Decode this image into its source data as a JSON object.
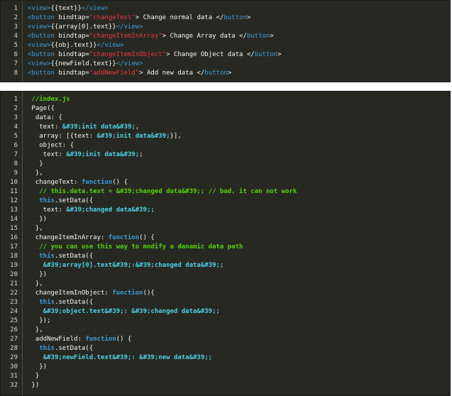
{
  "wxml_snippet": {
    "lines": [
      [
        {
          "t": "<view>",
          "c": "tag"
        },
        {
          "t": "{{text}}",
          "c": "pl"
        },
        {
          "t": "</view>",
          "c": "tag"
        }
      ],
      [
        {
          "t": "<button",
          "c": "tag"
        },
        {
          "t": " bindtap=",
          "c": "pl"
        },
        {
          "t": "\"changeText\"",
          "c": "str"
        },
        {
          "t": "> Change normal data </",
          "c": "pl"
        },
        {
          "t": "button",
          "c": "tag"
        },
        {
          "t": ">",
          "c": "pl"
        }
      ],
      [
        {
          "t": "<view>",
          "c": "tag"
        },
        {
          "t": "{{array[0].text}}",
          "c": "pl"
        },
        {
          "t": "</view>",
          "c": "tag"
        }
      ],
      [
        {
          "t": "<button",
          "c": "tag"
        },
        {
          "t": " bindtap=",
          "c": "pl"
        },
        {
          "t": "\"changeItemInArray\"",
          "c": "str"
        },
        {
          "t": "> Change Array data </",
          "c": "pl"
        },
        {
          "t": "button",
          "c": "tag"
        },
        {
          "t": ">",
          "c": "pl"
        }
      ],
      [
        {
          "t": "<view>",
          "c": "tag"
        },
        {
          "t": "{{obj.text}}",
          "c": "pl"
        },
        {
          "t": "</view>",
          "c": "tag"
        }
      ],
      [
        {
          "t": "<button",
          "c": "tag"
        },
        {
          "t": " bindtap=",
          "c": "pl"
        },
        {
          "t": "\"changeItemInObject\"",
          "c": "str"
        },
        {
          "t": "> Change Object data </",
          "c": "pl"
        },
        {
          "t": "button",
          "c": "tag"
        },
        {
          "t": ">",
          "c": "pl"
        }
      ],
      [
        {
          "t": "<view>",
          "c": "tag"
        },
        {
          "t": "{{newField.text}}",
          "c": "pl"
        },
        {
          "t": "</view>",
          "c": "tag"
        }
      ],
      [
        {
          "t": "<button",
          "c": "tag"
        },
        {
          "t": " bindtap=",
          "c": "pl"
        },
        {
          "t": "\"addNewField\"",
          "c": "str"
        },
        {
          "t": "> Add new data </",
          "c": "pl"
        },
        {
          "t": "button",
          "c": "tag"
        },
        {
          "t": ">",
          "c": "pl"
        }
      ]
    ]
  },
  "js_snippet": {
    "lines": [
      [
        {
          "t": " //index.js",
          "c": "cm"
        }
      ],
      [
        {
          "t": " Page({",
          "c": "pl"
        }
      ],
      [
        {
          "t": "  data: {",
          "c": "pl"
        }
      ],
      [
        {
          "t": "   text: ",
          "c": "pl"
        },
        {
          "t": "&#39;init data&#39;",
          "c": "lit"
        },
        {
          "t": ",",
          "c": "pl"
        }
      ],
      [
        {
          "t": "   array: [{text: ",
          "c": "pl"
        },
        {
          "t": "&#39;init data&#39;",
          "c": "lit"
        },
        {
          "t": "}],",
          "c": "pl"
        }
      ],
      [
        {
          "t": "   object: {",
          "c": "pl"
        }
      ],
      [
        {
          "t": "    text: ",
          "c": "pl"
        },
        {
          "t": "&#39;init data&#39;",
          "c": "lit"
        },
        {
          "t": ";",
          "c": "pl"
        }
      ],
      [
        {
          "t": "   }",
          "c": "pl"
        }
      ],
      [
        {
          "t": "  },",
          "c": "pl"
        }
      ],
      [
        {
          "t": "  changeText: ",
          "c": "pl"
        },
        {
          "t": "function",
          "c": "kw"
        },
        {
          "t": "() {",
          "c": "pl"
        }
      ],
      [
        {
          "t": "   // this.data.text = &#39;changed data&#39;; // bad, it can not work",
          "c": "cm"
        }
      ],
      [
        {
          "t": "   ",
          "c": "pl"
        },
        {
          "t": "this",
          "c": "kw"
        },
        {
          "t": ".setData({",
          "c": "pl"
        }
      ],
      [
        {
          "t": "    text: ",
          "c": "pl"
        },
        {
          "t": "&#39;changed data&#39;;",
          "c": "lit"
        }
      ],
      [
        {
          "t": "   })",
          "c": "pl"
        }
      ],
      [
        {
          "t": "  },",
          "c": "pl"
        }
      ],
      [
        {
          "t": "  changeItemInArray: ",
          "c": "pl"
        },
        {
          "t": "function",
          "c": "kw"
        },
        {
          "t": "() {",
          "c": "pl"
        }
      ],
      [
        {
          "t": "   // you can use this way to modify a danamic data path",
          "c": "cm"
        }
      ],
      [
        {
          "t": "   ",
          "c": "pl"
        },
        {
          "t": "this",
          "c": "kw"
        },
        {
          "t": ".setData({",
          "c": "pl"
        }
      ],
      [
        {
          "t": "    ",
          "c": "pl"
        },
        {
          "t": "&#39;array[0].text&#39;:&#39;changed data&#39;;",
          "c": "lit"
        }
      ],
      [
        {
          "t": "   })",
          "c": "pl"
        }
      ],
      [
        {
          "t": "  },",
          "c": "pl"
        }
      ],
      [
        {
          "t": "  changeItemInObject: ",
          "c": "pl"
        },
        {
          "t": "function",
          "c": "kw"
        },
        {
          "t": "(){",
          "c": "pl"
        }
      ],
      [
        {
          "t": "   ",
          "c": "pl"
        },
        {
          "t": "this",
          "c": "kw"
        },
        {
          "t": ".setData({",
          "c": "pl"
        }
      ],
      [
        {
          "t": "    ",
          "c": "pl"
        },
        {
          "t": "&#39;object.text&#39;: &#39;changed data&#39;;",
          "c": "lit"
        }
      ],
      [
        {
          "t": "   });",
          "c": "pl"
        }
      ],
      [
        {
          "t": "  },",
          "c": "pl"
        }
      ],
      [
        {
          "t": "  addNewField: ",
          "c": "pl"
        },
        {
          "t": "function",
          "c": "kw"
        },
        {
          "t": "() {",
          "c": "pl"
        }
      ],
      [
        {
          "t": "   ",
          "c": "pl"
        },
        {
          "t": "this",
          "c": "kw"
        },
        {
          "t": ".setData({",
          "c": "pl"
        }
      ],
      [
        {
          "t": "    ",
          "c": "pl"
        },
        {
          "t": "&#39;newField.text&#39;: &#39;new data&#39;;",
          "c": "lit"
        }
      ],
      [
        {
          "t": "   })",
          "c": "pl"
        }
      ],
      [
        {
          "t": "  }",
          "c": "pl"
        }
      ],
      [
        {
          "t": " })",
          "c": "pl"
        }
      ]
    ]
  }
}
